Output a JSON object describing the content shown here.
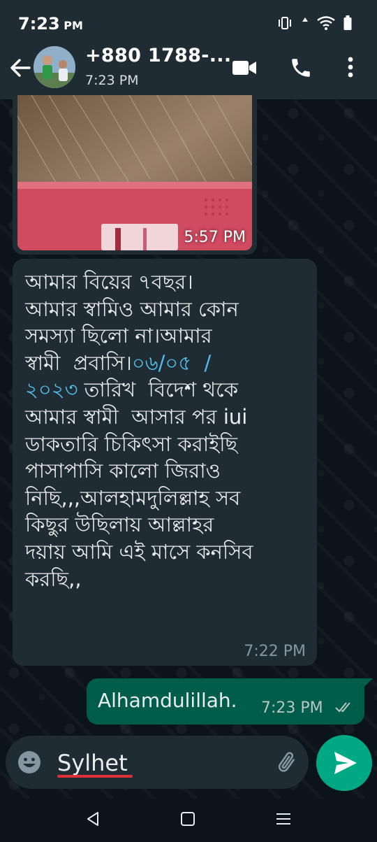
{
  "status_bar": {
    "time": "7:23",
    "ampm": "PM",
    "icons": [
      "vibrate-icon",
      "data-arrows-icon",
      "wifi-icon",
      "battery-icon"
    ]
  },
  "header": {
    "contact_name": "+880 1788-...",
    "subtitle": "7:23 PM",
    "icons": [
      "back-arrow-icon",
      "video-call-icon",
      "phone-icon",
      "more-vertical-icon"
    ]
  },
  "messages": [
    {
      "type": "image",
      "direction": "incoming",
      "time": "5:57 PM"
    },
    {
      "type": "text",
      "direction": "incoming",
      "text_before_link": "আমার বিয়ের ৭বছর।\nআমার স্বামিও আমার কোন\nসমস্যা ছিলো না।আমার\nস্বামী  প্রবাসি।",
      "link_text": "০৬/০৫  /\n২০২৩",
      "text_after_link": " তারিখ  বিদেশ থকে\nআমার স্বামী  আসার পর iui\nডাকতারি চিকিৎসা করাইছি\nপাসাপাসি কালো জিরাও\nনিছি,,,আলহামদুলিল্লাহ সব\nকিছুর উছিলায় আল্লাহর\nদয়ায় আমি এই মাসে কনসিব\nকরছি,,",
      "time": "7:22 PM"
    },
    {
      "type": "text",
      "direction": "outgoing",
      "text": "Alhamdulillah.",
      "time": "7:23 PM",
      "read_status_icon": "double-check-icon"
    }
  ],
  "composer": {
    "input_value": "Sylhet",
    "icons": [
      "emoji-icon",
      "attach-icon",
      "send-icon"
    ]
  },
  "nav_bar": {
    "icons": [
      "nav-back-icon",
      "nav-home-icon",
      "nav-recents-icon"
    ]
  },
  "colors": {
    "background": "#0b141a",
    "header": "#1f2c34",
    "incoming_bubble": "#202c33",
    "outgoing_bubble": "#005c4b",
    "accent": "#00a884",
    "link": "#53bdeb"
  }
}
